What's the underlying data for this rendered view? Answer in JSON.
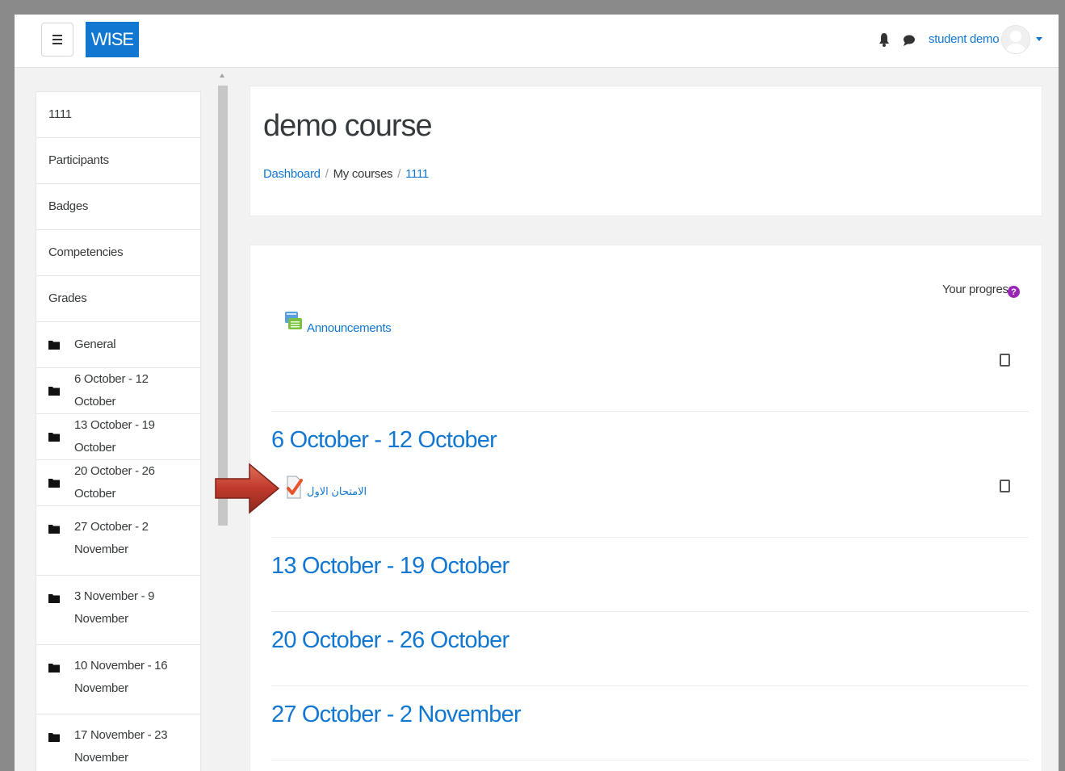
{
  "navbar": {
    "brand": "WISE",
    "username": "student demo"
  },
  "icons": {
    "menu": "hamburger-icon",
    "notifications": "bell-icon",
    "messages": "chat-bubble-icon",
    "user_menu": "caret-down-icon",
    "folder": "folder-icon",
    "help": "question-icon",
    "forum": "forum-icon",
    "quiz": "quiz-checkmark-icon",
    "annotation": "red-arrow-icon"
  },
  "drawer": {
    "items": [
      {
        "label": "1111"
      },
      {
        "label": "Participants"
      },
      {
        "label": "Badges"
      },
      {
        "label": "Competencies"
      },
      {
        "label": "Grades"
      },
      {
        "label": "General"
      },
      {
        "label": "6 October - 12 October"
      },
      {
        "label": "13 October - 19 October"
      },
      {
        "label": "20 October - 26 October"
      },
      {
        "label_line1": "27 October - 2",
        "label_line2": "November"
      },
      {
        "label_line1": "3 November - 9",
        "label_line2": "November"
      },
      {
        "label_line1": "10 November - 16",
        "label_line2": "November"
      },
      {
        "label_line1": "17 November - 23",
        "label_line2": "November"
      }
    ]
  },
  "header": {
    "title": "demo course",
    "breadcrumb": {
      "dashboard": "Dashboard",
      "separator": "/",
      "my_courses": "My courses",
      "course": "1111"
    }
  },
  "main": {
    "progress_label": "Your progress",
    "help_glyph": "?",
    "announcements": "Announcements",
    "sections": [
      {
        "title": "6 October - 12 October"
      },
      {
        "title": "13 October - 19 October"
      },
      {
        "title": "20 October - 26 October"
      },
      {
        "title": "27 October - 2 November"
      }
    ],
    "quiz_activity": "الامتحان الاول"
  },
  "colors": {
    "brand": "#1177d1",
    "link": "#1177d1",
    "help_badge": "#9b26b6",
    "arrow": "#c0392b"
  }
}
